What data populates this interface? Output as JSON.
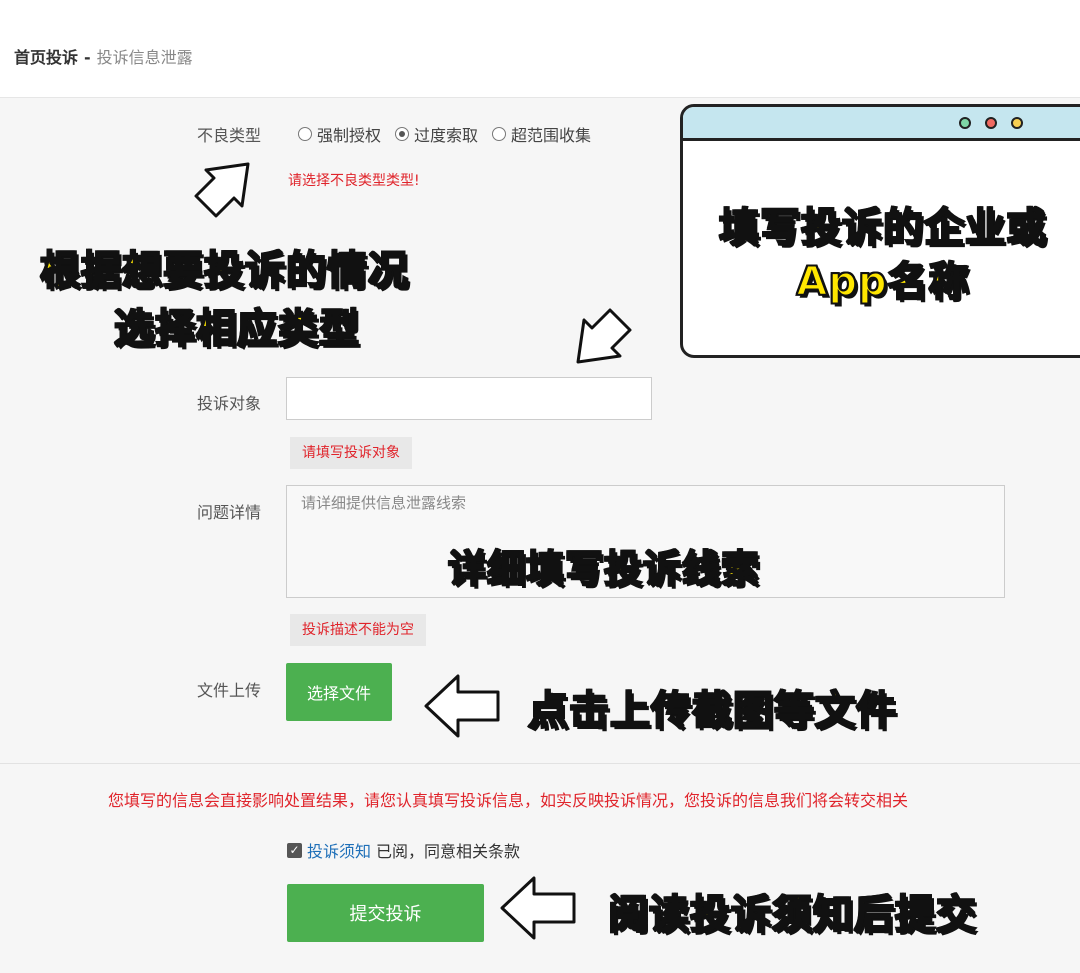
{
  "breadcrumb": {
    "home": "首页投诉",
    "sep": "-",
    "current": "投诉信息泄露"
  },
  "form": {
    "type_label": "不良类型",
    "type_options": [
      {
        "label": "强制授权",
        "selected": false
      },
      {
        "label": "过度索取",
        "selected": true
      },
      {
        "label": "超范围收集",
        "selected": false
      }
    ],
    "type_error": "请选择不良类型类型!",
    "target_label": "投诉对象",
    "target_value": "",
    "target_error": "请填写投诉对象",
    "details_label": "问题详情",
    "details_placeholder": "请详细提供信息泄露线索",
    "details_error": "投诉描述不能为空",
    "upload_label": "文件上传",
    "upload_button": "选择文件"
  },
  "footer": {
    "notice": "您填写的信息会直接影响处置结果，请您认真填写投诉信息，如实反映投诉情况，您投诉的信息我们将会转交相关",
    "agree_checked": true,
    "agree_link": "投诉须知",
    "agree_text": "已阅，同意相关条款",
    "submit_label": "提交投诉"
  },
  "annotations": {
    "type_hint_1": "根据想要投诉的情况",
    "type_hint_2": "选择相应类型",
    "target_hint_1": "填写投诉的企业或",
    "target_hint_2": "App名称",
    "details_hint": "详细填写投诉线索",
    "upload_hint": "点击上传截图等文件",
    "submit_hint": "阅读投诉须知后提交"
  },
  "colors": {
    "accent_green": "#4cb050",
    "error_red": "#e0242b",
    "link_blue": "#1e6fb8",
    "annotation_yellow": "#ffe600"
  }
}
